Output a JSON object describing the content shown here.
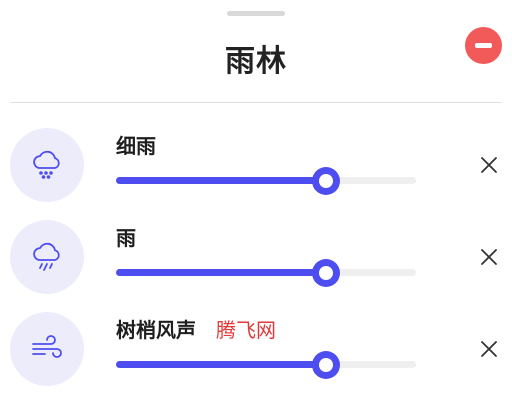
{
  "header": {
    "title": "雨林",
    "remove_icon": "minus-circle-icon",
    "accent_color": "#f25a5a"
  },
  "sounds": [
    {
      "label": "细雨",
      "icon": "cloud-drizzle-icon",
      "volume": 0.7,
      "watermark": ""
    },
    {
      "label": "雨",
      "icon": "cloud-rain-icon",
      "volume": 0.7,
      "watermark": ""
    },
    {
      "label": "树梢风声",
      "icon": "wind-icon",
      "volume": 0.7,
      "watermark": "腾飞网"
    }
  ],
  "colors": {
    "slider_accent": "#4e4ef0",
    "icon_bg": "#ececfb"
  }
}
